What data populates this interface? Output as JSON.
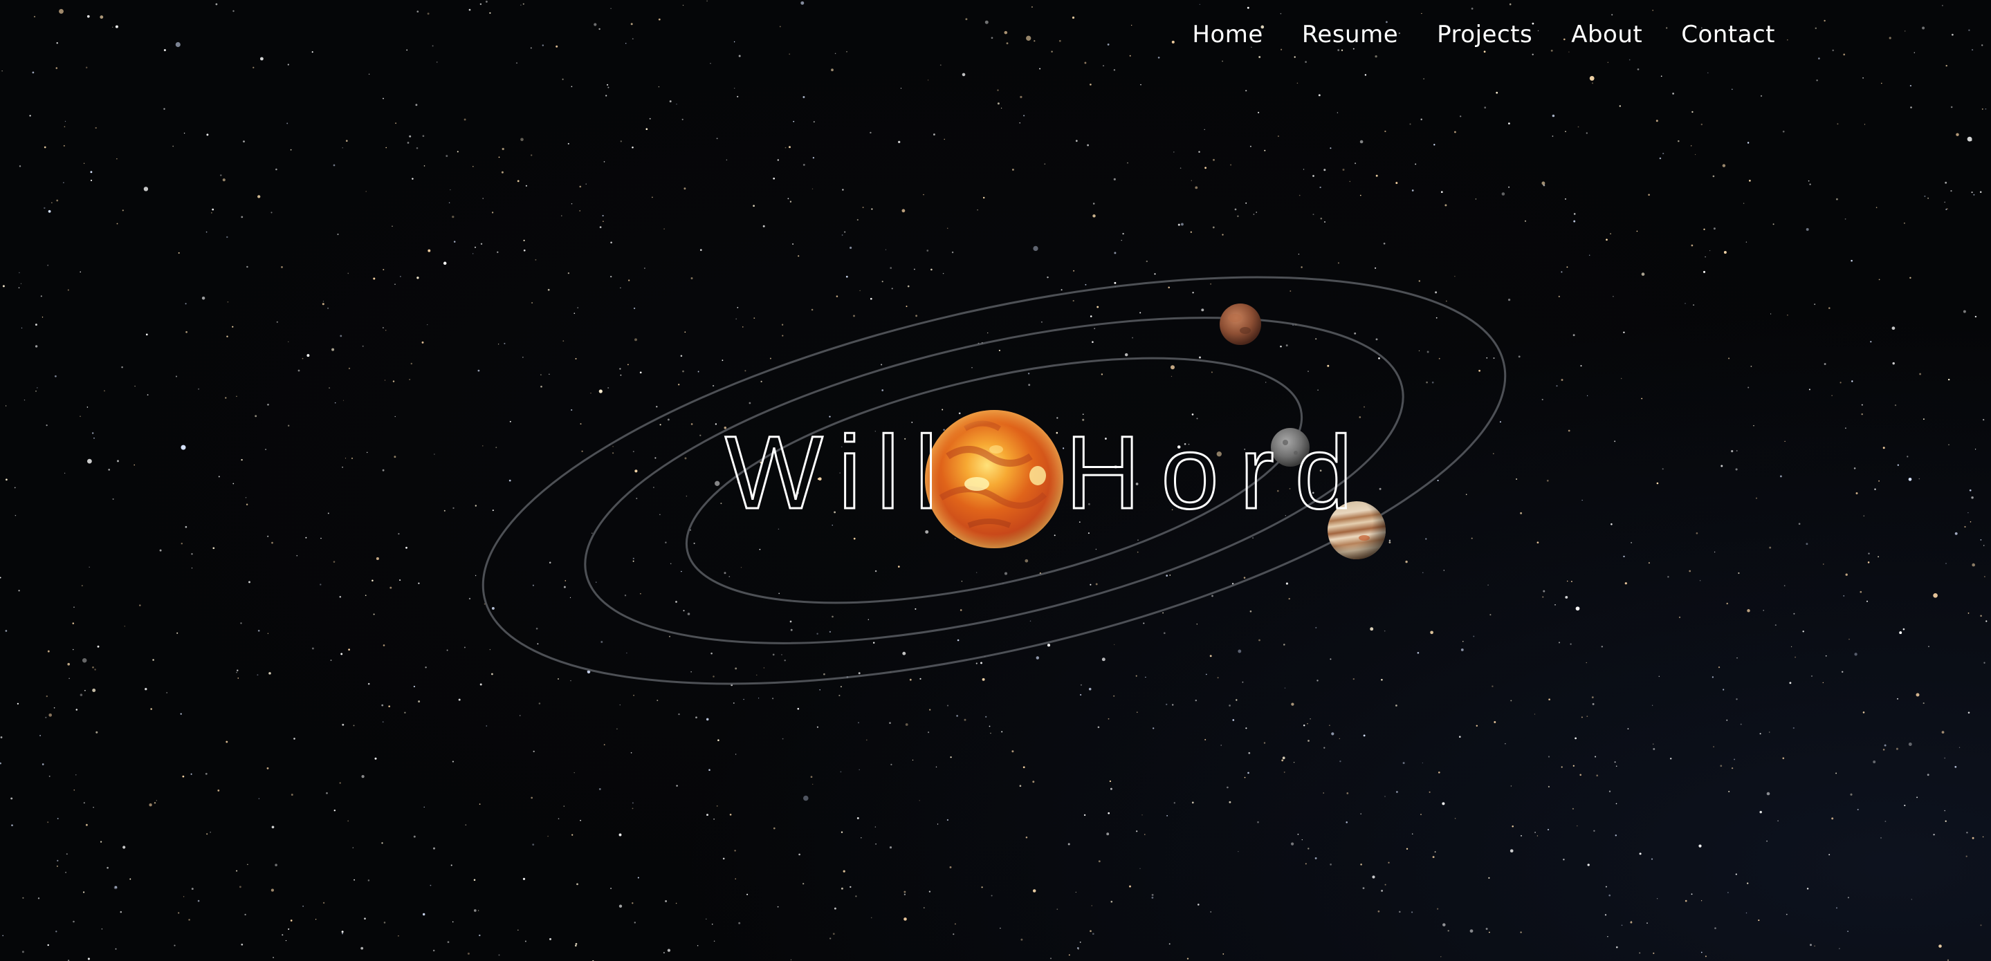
{
  "nav": {
    "items": [
      "Home",
      "Resume",
      "Projects",
      "About",
      "Contact"
    ]
  },
  "hero": {
    "title_left": "Will",
    "title_right": "Hord",
    "center_icon": "sun-icon",
    "planets": [
      "mars-icon",
      "mercury-icon",
      "jupiter-icon"
    ]
  },
  "colors": {
    "background": "#050608",
    "text": "#ffffff",
    "orbit": "#5a5d63"
  }
}
